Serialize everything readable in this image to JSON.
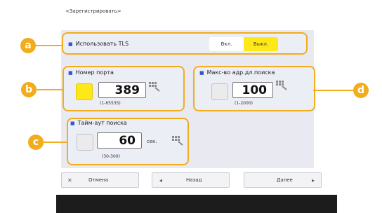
{
  "header": {
    "title": "<Зарегистрировать>"
  },
  "tls": {
    "label": "Использовать TLS",
    "on_label": "Вкл.",
    "off_label": "Выкл.",
    "selected": "Выкл."
  },
  "port": {
    "label": "Номер порта",
    "value": "389",
    "range": "(1-65535)"
  },
  "max_search": {
    "label": "Макс-во адр.дл.поиска",
    "value": "100",
    "range": "(1-2000)"
  },
  "timeout": {
    "label": "Тайм-аут поиска",
    "value": "60",
    "unit": "сек.",
    "range": "(30-300)"
  },
  "callouts": {
    "a": "a",
    "b": "b",
    "c": "c",
    "d": "d"
  },
  "footer": {
    "cancel_label": "Отмена",
    "back_label": "Назад",
    "next_label": "Далее"
  },
  "colors": {
    "accent": "#f2ac1c",
    "selected_fill": "#ffe817",
    "bullet": "#3a56c9",
    "panel": "#e9eaf1"
  }
}
